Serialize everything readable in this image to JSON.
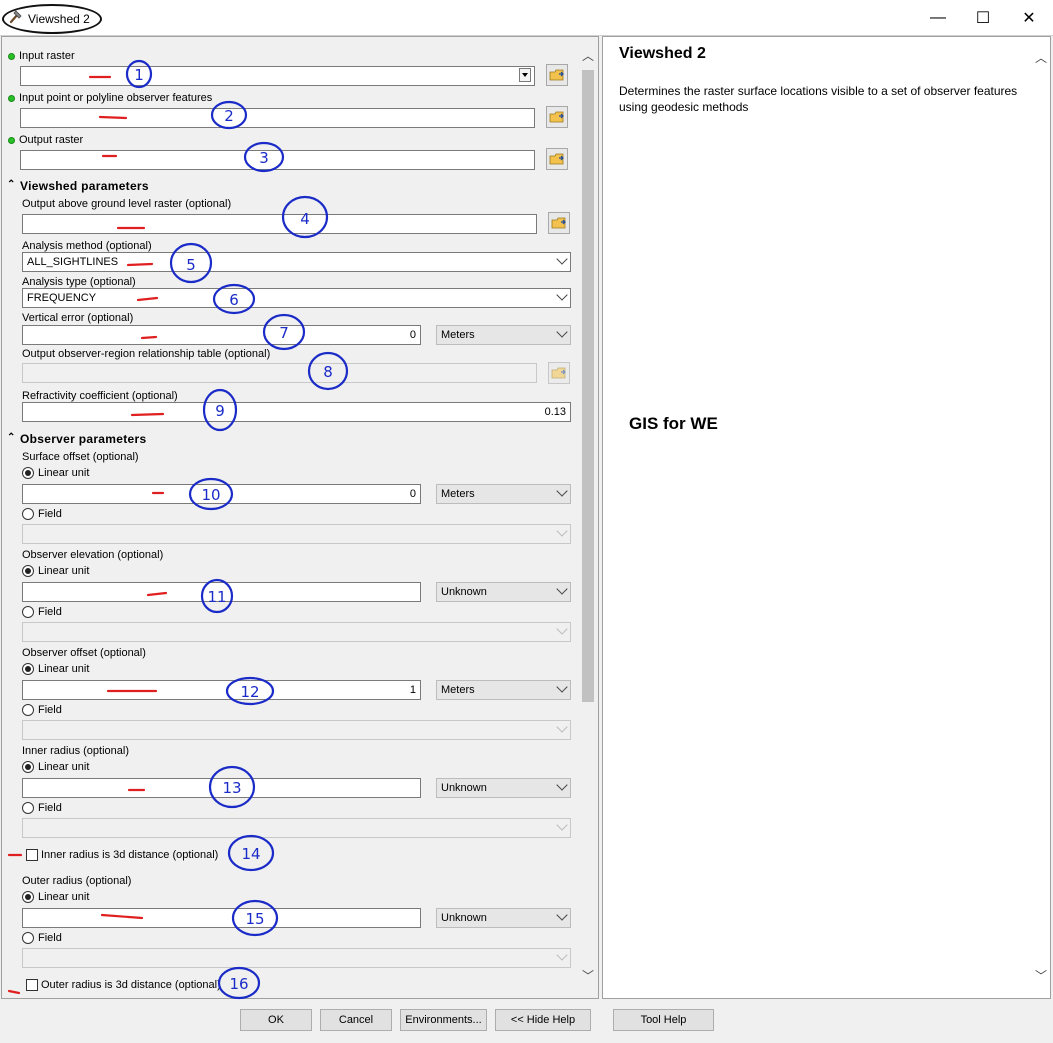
{
  "window": {
    "title": "Viewshed 2",
    "minimize": "—",
    "maximize": "☐",
    "close": "✕"
  },
  "parameters": {
    "input_raster": {
      "label": "Input raster",
      "value": ""
    },
    "observer_features": {
      "label": "Input point or polyline observer features",
      "value": ""
    },
    "output_raster": {
      "label": "Output raster",
      "value": ""
    },
    "viewshed_section": "Viewshed parameters",
    "agl_raster": {
      "label": "Output above ground level raster (optional)",
      "value": ""
    },
    "analysis_method": {
      "label": "Analysis method (optional)",
      "value": "ALL_SIGHTLINES"
    },
    "analysis_type": {
      "label": "Analysis type (optional)",
      "value": "FREQUENCY"
    },
    "vertical_error": {
      "label": "Vertical error (optional)",
      "value": "0",
      "unit": "Meters"
    },
    "relationship_table": {
      "label": "Output observer-region relationship table (optional)",
      "value": ""
    },
    "refractivity": {
      "label": "Refractivity coefficient (optional)",
      "value": "0.13"
    },
    "observer_section": "Observer parameters",
    "surface_offset": {
      "label": "Surface offset (optional)",
      "linear_label": "Linear unit",
      "field_label": "Field",
      "value": "0",
      "unit": "Meters"
    },
    "observer_elevation": {
      "label": "Observer elevation (optional)",
      "linear_label": "Linear unit",
      "field_label": "Field",
      "value": "",
      "unit": "Unknown"
    },
    "observer_offset": {
      "label": "Observer offset (optional)",
      "linear_label": "Linear unit",
      "field_label": "Field",
      "value": "1",
      "unit": "Meters"
    },
    "inner_radius": {
      "label": "Inner radius (optional)",
      "linear_label": "Linear unit",
      "field_label": "Field",
      "value": "",
      "unit": "Unknown"
    },
    "inner_3d": {
      "label": "Inner radius is 3d distance (optional)"
    },
    "outer_radius": {
      "label": "Outer radius (optional)",
      "linear_label": "Linear unit",
      "field_label": "Field",
      "value": "",
      "unit": "Unknown"
    },
    "outer_3d": {
      "label": "Outer radius is 3d distance (optional)"
    }
  },
  "buttons": {
    "ok": "OK",
    "cancel": "Cancel",
    "environments": "Environments...",
    "hide_help": "<< Hide Help",
    "tool_help": "Tool Help"
  },
  "help": {
    "title": "Viewshed 2",
    "description": "Determines the raster surface locations visible to a set of observer features using geodesic methods",
    "watermark": "GIS for WE"
  },
  "annotations": [
    "1",
    "2",
    "3",
    "4",
    "5",
    "6",
    "7",
    "8",
    "9",
    "10",
    "11",
    "12",
    "13",
    "14",
    "15",
    "16"
  ],
  "colors": {
    "status_dot": "#27c027",
    "annotation_ink": "#1a2bc8",
    "underline_ink": "#e02020"
  }
}
